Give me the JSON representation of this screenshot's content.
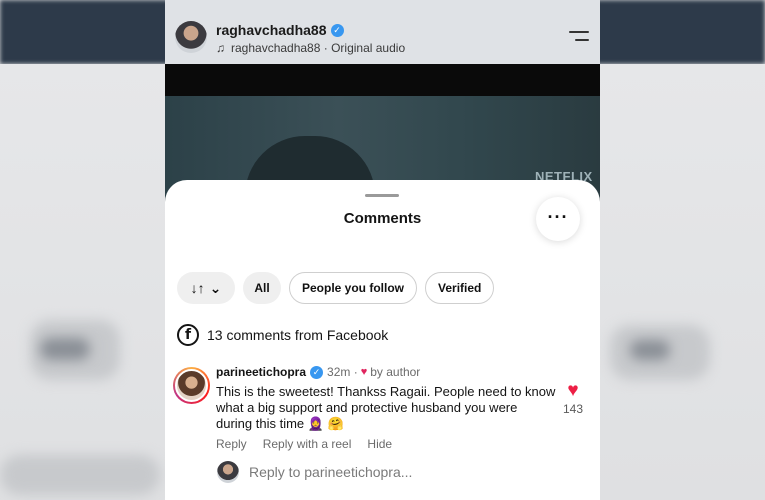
{
  "header": {
    "username": "raghavchadha88",
    "audio_label": "raghavchadha88 · Original audio",
    "verified_mark": "✓"
  },
  "video": {
    "watermark": "NETFLIX"
  },
  "comments_sheet": {
    "title": "Comments",
    "more_label": "···",
    "filters": {
      "sort_label": "↓↑",
      "sort_caret": "⌄",
      "all": "All",
      "people_you_follow": "People you follow",
      "verified": "Verified"
    },
    "facebook_row": {
      "icon_glyph": "f",
      "text": "13 comments from Facebook"
    },
    "comment": {
      "username": "parineetichopra",
      "time": "32m ·",
      "by_author": "by author",
      "text": "This is the sweetest! Thankss Ragaii. People need to know what a big support and protective husband you were during this time 🧕 🤗",
      "likes": "143",
      "actions": {
        "reply": "Reply",
        "reply_with_reel": "Reply with a reel",
        "hide": "Hide"
      }
    },
    "reply_input": {
      "placeholder": "Reply to parineetichopra..."
    }
  },
  "colors": {
    "like_red": "#ed1f45",
    "verified_blue": "#3897f0"
  }
}
